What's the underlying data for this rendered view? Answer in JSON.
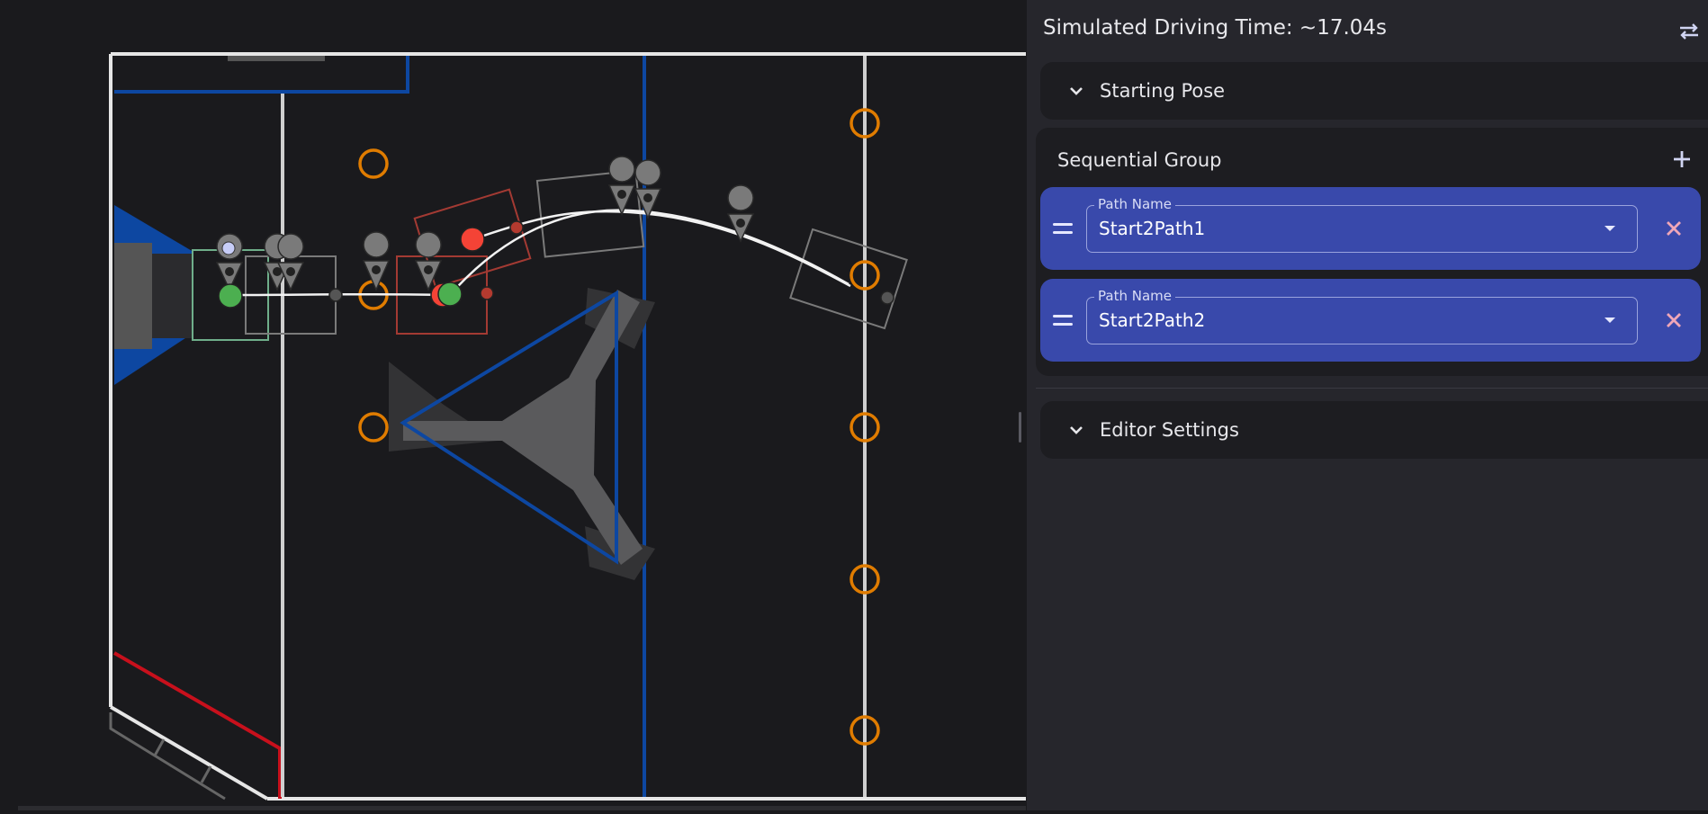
{
  "panel": {
    "title": "Simulated Driving Time: ~17.04s",
    "swap_icon": "swap-icon",
    "starting_pose": {
      "label": "Starting Pose",
      "icon": "chevron-down-icon"
    },
    "sequential_group": {
      "label": "Sequential Group",
      "add_icon": "plus-icon",
      "items": [
        {
          "field_label": "Path Name",
          "value": "Start2Path1"
        },
        {
          "field_label": "Path Name",
          "value": "Start2Path2"
        }
      ]
    },
    "editor_settings": {
      "label": "Editor Settings",
      "icon": "chevron-down-icon"
    }
  },
  "colors": {
    "background": "#1a1a1d",
    "panel": "#26262c",
    "card": "#1d1d21",
    "accent": "#3949ab",
    "delete": "#f0a7b8",
    "alliance_blue": "#0d47a1",
    "alliance_red": "#c8101c",
    "orange_ring": "#e07c00",
    "waypoint_green": "#4caf50",
    "waypoint_red": "#f44336"
  }
}
